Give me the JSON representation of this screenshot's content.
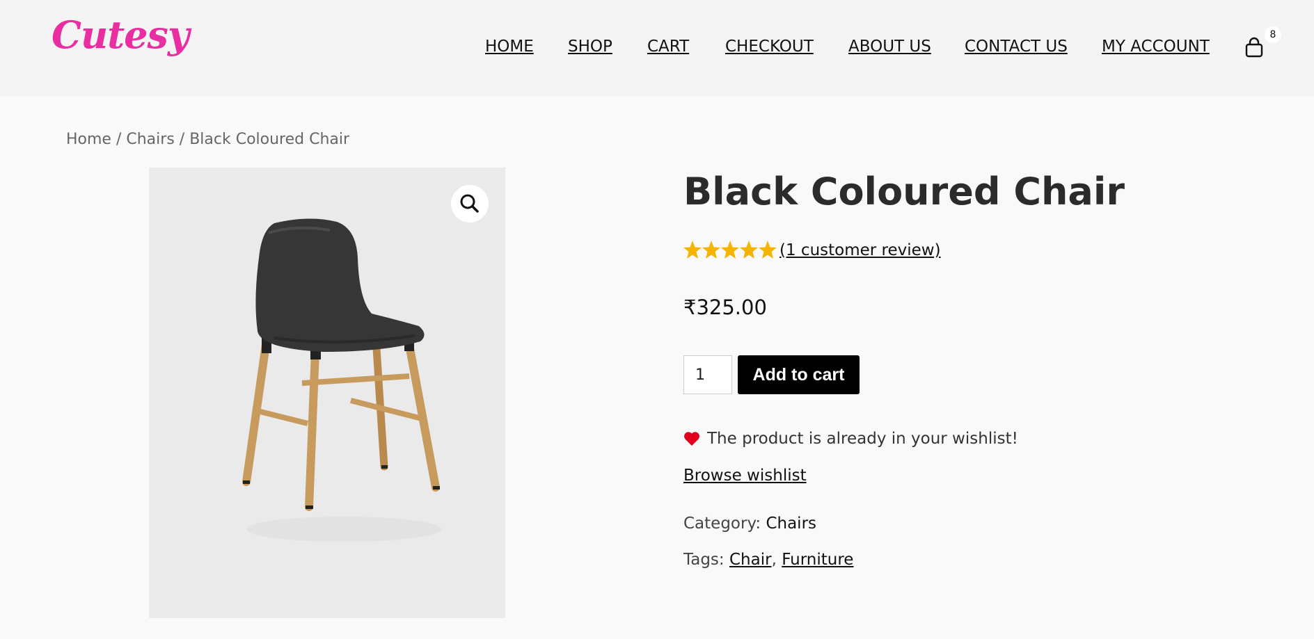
{
  "brand": {
    "logo_text": "Cutesy",
    "logo_color": "#e82ea0"
  },
  "nav": {
    "items": [
      {
        "label": "HOME"
      },
      {
        "label": "SHOP"
      },
      {
        "label": "CART"
      },
      {
        "label": "CHECKOUT"
      },
      {
        "label": "ABOUT US"
      },
      {
        "label": "CONTACT US"
      },
      {
        "label": "MY ACCOUNT"
      }
    ],
    "cart_count": "8",
    "cart_icon": "shopping-bag-icon"
  },
  "breadcrumb": {
    "home": "Home",
    "sep": " / ",
    "category": "Chairs",
    "current": "Black Coloured Chair"
  },
  "gallery": {
    "zoom_icon": "magnifier-icon",
    "image": "black-chair-wooden-legs"
  },
  "product": {
    "title": "Black Coloured Chair",
    "rating": {
      "stars": 5,
      "max": 5,
      "review_link": "(1 customer review)",
      "star_color": "#f4b400"
    },
    "price": "₹325.00",
    "quantity": "1",
    "add_to_cart": "Add to cart",
    "wishlist_message": "The product is already in your wishlist!",
    "wishlist_icon": "heart-icon",
    "heart_color": "#e0001b",
    "browse_wishlist": "Browse wishlist",
    "category_label": "Category:",
    "category_value": "Chairs",
    "tags_label": "Tags:",
    "tags": [
      "Chair",
      "Furniture"
    ],
    "tag_separator": ","
  }
}
